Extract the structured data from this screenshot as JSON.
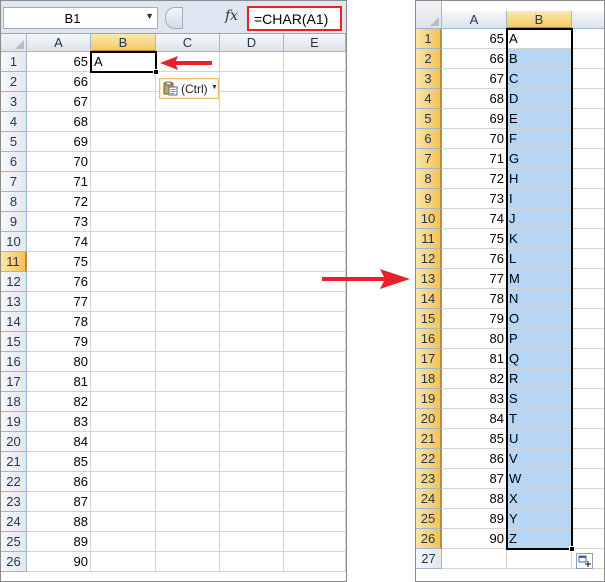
{
  "formula_bar": {
    "name_box": "B1",
    "fx_label": "fx",
    "formula": "=CHAR(A1)"
  },
  "left_sheet": {
    "columns": [
      "A",
      "B",
      "C",
      "D",
      "E"
    ],
    "rows": [
      "1",
      "2",
      "3",
      "4",
      "5",
      "6",
      "7",
      "8",
      "9",
      "10",
      "11",
      "12",
      "13",
      "14",
      "15",
      "16",
      "17",
      "18",
      "19",
      "20",
      "21",
      "22",
      "23",
      "24",
      "25",
      "26"
    ],
    "col_a_values": [
      "65",
      "66",
      "67",
      "68",
      "69",
      "70",
      "71",
      "72",
      "73",
      "74",
      "75",
      "76",
      "77",
      "78",
      "79",
      "80",
      "81",
      "82",
      "83",
      "84",
      "85",
      "86",
      "87",
      "88",
      "89",
      "90"
    ],
    "b1_value": "A",
    "paste_options_label": "(Ctrl)",
    "selected_column": "B",
    "selected_row": "11"
  },
  "right_sheet": {
    "columns": [
      "A",
      "B"
    ],
    "rows": [
      "1",
      "2",
      "3",
      "4",
      "5",
      "6",
      "7",
      "8",
      "9",
      "10",
      "11",
      "12",
      "13",
      "14",
      "15",
      "16",
      "17",
      "18",
      "19",
      "20",
      "21",
      "22",
      "23",
      "24",
      "25",
      "26",
      "27"
    ],
    "col_a_values": [
      "65",
      "66",
      "67",
      "68",
      "69",
      "70",
      "71",
      "72",
      "73",
      "74",
      "75",
      "76",
      "77",
      "78",
      "79",
      "80",
      "81",
      "82",
      "83",
      "84",
      "85",
      "86",
      "87",
      "88",
      "89",
      "90"
    ],
    "col_b_values": [
      "A",
      "B",
      "C",
      "D",
      "E",
      "F",
      "G",
      "H",
      "I",
      "J",
      "K",
      "L",
      "M",
      "N",
      "O",
      "P",
      "Q",
      "R",
      "S",
      "T",
      "U",
      "V",
      "W",
      "X",
      "Y",
      "Z"
    ],
    "selected_column": "B",
    "selected_rows_from": "1",
    "selected_rows_to": "26"
  },
  "colors": {
    "highlight_red": "#e8202a",
    "selection_fill": "#b7d6f5",
    "header_selected": "#f5c962"
  }
}
